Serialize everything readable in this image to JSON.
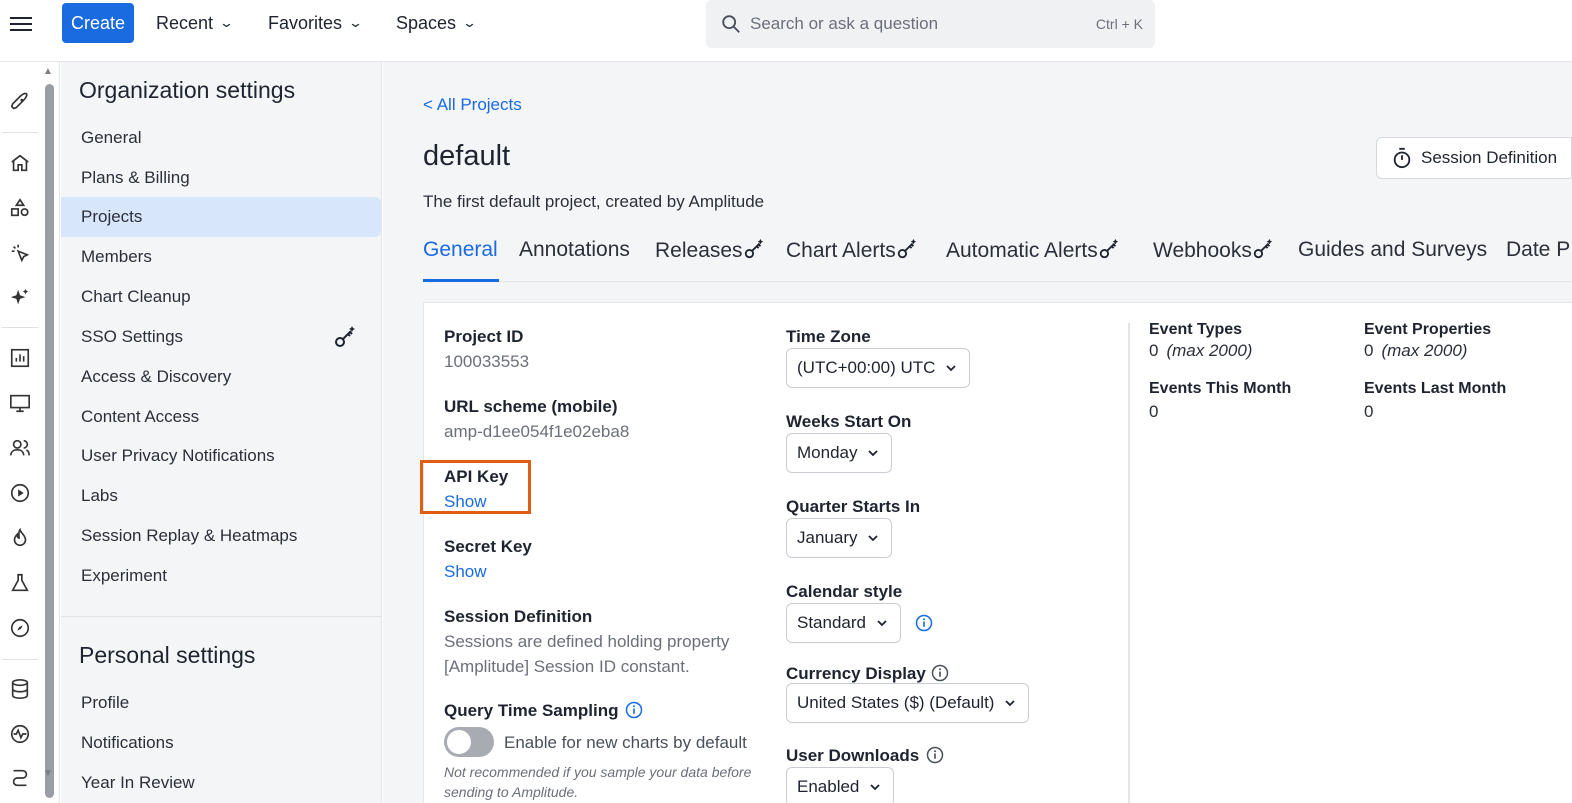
{
  "topbar": {
    "create_label": "Create",
    "nav": [
      {
        "label": "Recent"
      },
      {
        "label": "Favorites"
      },
      {
        "label": "Spaces"
      }
    ],
    "search_placeholder": "Search or ask a question",
    "search_shortcut": "Ctrl + K"
  },
  "rail_icons": [
    "rocket-icon",
    "home-icon",
    "shapes-icon",
    "cursor-click-icon",
    "sparkle-icon",
    "bar-chart-icon",
    "monitor-icon",
    "users-icon",
    "play-icon",
    "flame-icon",
    "flask-icon",
    "compass-icon",
    "database-icon",
    "activity-icon",
    "route-icon"
  ],
  "sidebar": {
    "org_title": "Organization settings",
    "items": [
      {
        "label": "General"
      },
      {
        "label": "Plans & Billing"
      },
      {
        "label": "Projects"
      },
      {
        "label": "Members"
      },
      {
        "label": "Chart Cleanup"
      },
      {
        "label": "SSO Settings"
      },
      {
        "label": "Access & Discovery"
      },
      {
        "label": "Content Access"
      },
      {
        "label": "User Privacy Notifications"
      },
      {
        "label": "Labs"
      },
      {
        "label": "Session Replay & Heatmaps"
      },
      {
        "label": "Experiment"
      }
    ],
    "personal_title": "Personal settings",
    "personal_items": [
      {
        "label": "Profile"
      },
      {
        "label": "Notifications"
      },
      {
        "label": "Year In Review"
      }
    ]
  },
  "main": {
    "back_link": "< All Projects",
    "title": "default",
    "description": "The first default project, created by Amplitude",
    "session_button": "Session Definition",
    "tabs": [
      {
        "label": "General"
      },
      {
        "label": "Annotations"
      },
      {
        "label": "Releases"
      },
      {
        "label": "Chart Alerts"
      },
      {
        "label": "Automatic Alerts"
      },
      {
        "label": "Webhooks"
      },
      {
        "label": "Guides and Surveys"
      },
      {
        "label": "Date P"
      }
    ],
    "left_col": {
      "project_id_label": "Project ID",
      "project_id_value": "100033553",
      "url_scheme_label": "URL scheme (mobile)",
      "url_scheme_value": "amp-d1ee054f1e02eba8",
      "api_key_label": "API Key",
      "api_key_link": "Show",
      "secret_key_label": "Secret Key",
      "secret_key_link": "Show",
      "session_def_label": "Session Definition",
      "session_def_line1": "Sessions are defined holding property",
      "session_def_line2": "[Amplitude] Session ID constant.",
      "qts_label": "Query Time Sampling",
      "qts_toggle_label": "Enable for new charts by default",
      "qts_note_line1": "Not recommended if you sample your data before",
      "qts_note_line2": "sending to Amplitude."
    },
    "mid_col": {
      "timezone_label": "Time Zone",
      "timezone_value": "(UTC+00:00) UTC",
      "weeks_label": "Weeks Start On",
      "weeks_value": "Monday",
      "quarter_label": "Quarter Starts In",
      "quarter_value": "January",
      "calendar_label": "Calendar style",
      "calendar_value": "Standard",
      "currency_label": "Currency Display",
      "currency_value": "United States ($) (Default)",
      "downloads_label": "User Downloads",
      "downloads_value": "Enabled"
    },
    "stats": {
      "event_types_label": "Event Types",
      "event_types_value": "0",
      "event_types_max": "(max 2000)",
      "event_props_label": "Event Properties",
      "event_props_value": "0",
      "event_props_max": "(max 2000)",
      "events_this_month_label": "Events This Month",
      "events_this_month_value": "0",
      "events_last_month_label": "Events Last Month",
      "events_last_month_value": "0"
    }
  },
  "colors": {
    "accent": "#1a6ae0",
    "highlight": "#e05e12",
    "sidebar_active": "#d8e6fb"
  }
}
